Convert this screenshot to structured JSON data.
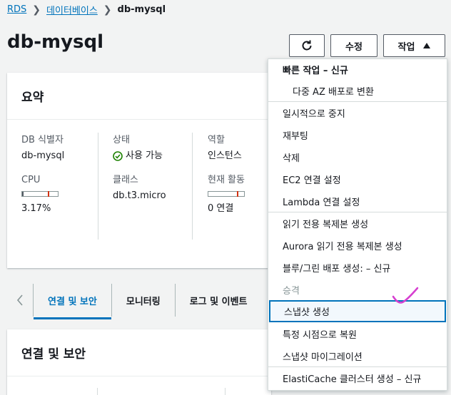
{
  "breadcrumb": {
    "items": [
      "RDS",
      "데이터베이스",
      "db-mysql"
    ]
  },
  "page": {
    "title": "db-mysql"
  },
  "toolbar": {
    "refresh_icon": "refresh-icon",
    "edit_label": "수정",
    "actions_label": "작업",
    "actions_icon": "caret-up-icon"
  },
  "summary": {
    "title": "요약",
    "db_identifier_label": "DB 식별자",
    "db_identifier_value": "db-mysql",
    "cpu_label": "CPU",
    "cpu_value": "3.17%",
    "cpu_percent": 3.17,
    "status_label": "상태",
    "status_value": "사용 가능",
    "class_label": "클래스",
    "class_value": "db.t3.micro",
    "role_label": "역할",
    "role_value": "인스턴스",
    "activity_label": "현재 활동",
    "activity_value": "0 연결"
  },
  "tabs": {
    "items": [
      "연결 및 보안",
      "모니터링",
      "로그 및 이벤트"
    ],
    "active_index": 0
  },
  "connection": {
    "title": "연결 및 보안"
  },
  "menu": {
    "quick_actions_title": "빠른 작업 – 신규",
    "multi_az": "다중 AZ 배포로 변환",
    "stop_temp": "일시적으로 중지",
    "reboot": "재부팅",
    "delete": "삭제",
    "ec2_conn": "EC2 연결 설정",
    "lambda_conn": "Lambda 연결 설정",
    "read_replica": "읽기 전용 복제본 생성",
    "aurora_replica": "Aurora 읽기 전용 복제본 생성",
    "bluegreen": "블루/그린 배포 생성: – 신규",
    "promote": "승격",
    "snapshot": "스냅샷 생성",
    "pitr": "특정 시점으로 복원",
    "migrate_snapshot": "스냅샷 마이그레이션",
    "elasticache": "ElastiCache 클러스터 생성 – 신규"
  },
  "colors": {
    "link": "#0073bb",
    "success": "#1d8102",
    "annotation": "#d63fd0"
  }
}
